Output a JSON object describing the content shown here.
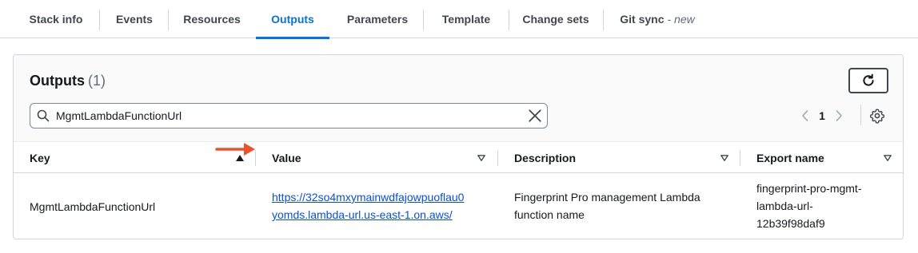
{
  "tabs": [
    {
      "label": "Stack info"
    },
    {
      "label": "Events"
    },
    {
      "label": "Resources"
    },
    {
      "label": "Outputs",
      "active": true
    },
    {
      "label": "Parameters"
    },
    {
      "label": "Template"
    },
    {
      "label": "Change sets"
    },
    {
      "label": "Git sync",
      "badge": "- new"
    }
  ],
  "outputs": {
    "title": "Outputs",
    "count": "(1)",
    "search": {
      "value": "MgmtLambdaFunctionUrl",
      "placeholder": "Search outputs"
    },
    "pagination": {
      "current_page": "1"
    },
    "columns": [
      {
        "label": "Key",
        "sort": "ascending"
      },
      {
        "label": "Value"
      },
      {
        "label": "Description"
      },
      {
        "label": "Export name"
      }
    ],
    "rows": [
      {
        "key": "MgmtLambdaFunctionUrl",
        "value_line1": "https://32so4mxymainwdfajowpuoflau0",
        "value_line2": "yomds.lambda-url.us-east-1.on.aws/",
        "description_line1": "Fingerprint Pro management Lambda",
        "description_line2": "function name",
        "export_line1": "fingerprint-pro-mgmt-",
        "export_line2": "lambda-url-",
        "export_line3": "12b39f98daf9"
      }
    ]
  },
  "colors": {
    "accent": "#0972d3",
    "link": "#0b4fd1",
    "annotation_arrow": "#e8532d"
  },
  "icons": [
    "search-icon",
    "clear-icon",
    "refresh-icon",
    "chevron-left-icon",
    "chevron-right-icon",
    "settings-icon",
    "sort-up-icon",
    "sort-down-icon",
    "arrow-annotation-icon"
  ]
}
